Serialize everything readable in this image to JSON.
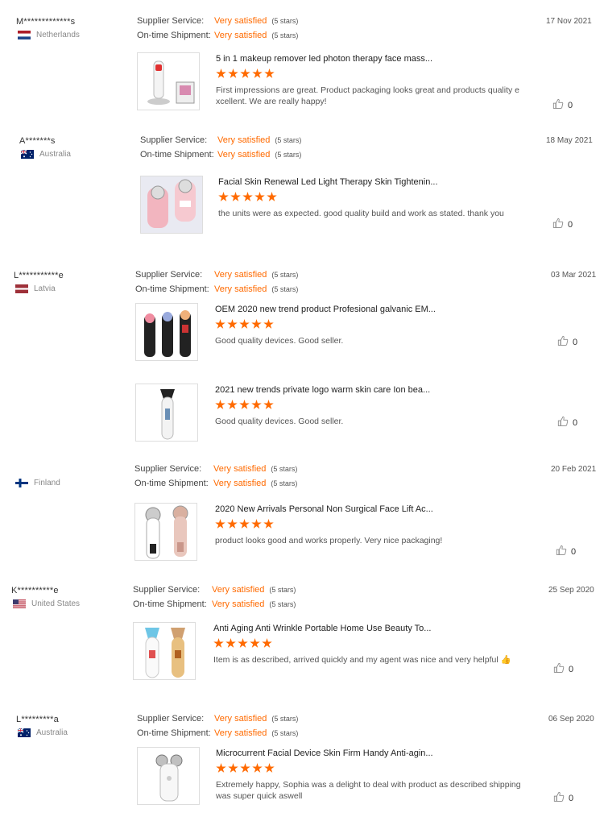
{
  "reviews": [
    {
      "buyer": "M*************s",
      "country": "Netherlands",
      "flag": "netherlands",
      "supplier_label": "Supplier Service:",
      "supplier_value": "Very satisfied",
      "supplier_stars": "(5 stars)",
      "shipment_label": "On-time Shipment:",
      "shipment_value": "Very satisfied",
      "shipment_stars": "(5 stars)",
      "date": "17 Nov 2021",
      "products": [
        {
          "title": "5 in 1 makeup remover led photon therapy face mass...",
          "rating": 5,
          "text": "First impressions are great. Product packaging looks great and products quality e xcellent. We are really happy!",
          "likes": "0",
          "image_icon": "face-massager-image"
        }
      ]
    },
    {
      "buyer": "A*******s",
      "country": "Australia",
      "flag": "australia",
      "supplier_label": "Supplier Service:",
      "supplier_value": "Very satisfied",
      "supplier_stars": "(5 stars)",
      "shipment_label": "On-time Shipment:",
      "shipment_value": "Very satisfied",
      "shipment_stars": "(5 stars)",
      "date": "18 May 2021",
      "products": [
        {
          "title": "Facial Skin Renewal Led Light Therapy Skin Tightenin...",
          "rating": 5,
          "text": "the units were as expected. good quality build and work as stated. thank you",
          "likes": "0",
          "image_icon": "pink-device-image"
        }
      ]
    },
    {
      "buyer": "L***********e",
      "country": "Latvia",
      "flag": "latvia",
      "supplier_label": "Supplier Service:",
      "supplier_value": "Very satisfied",
      "supplier_stars": "(5 stars)",
      "shipment_label": "On-time Shipment:",
      "shipment_value": "Very satisfied",
      "shipment_stars": "(5 stars)",
      "date": "03 Mar 2021",
      "products": [
        {
          "title": "OEM 2020 new trend product Profesional galvanic EM...",
          "rating": 5,
          "text": "Good quality devices. Good seller.",
          "likes": "0",
          "image_icon": "three-devices-image"
        },
        {
          "title": "2021 new trends private logo warm skin care Ion bea...",
          "rating": 5,
          "text": "Good quality devices. Good seller.",
          "likes": "0",
          "image_icon": "white-device-image"
        }
      ]
    },
    {
      "buyer": "",
      "country": "Finland",
      "flag": "finland",
      "supplier_label": "Supplier Service:",
      "supplier_value": "Very satisfied",
      "supplier_stars": "(5 stars)",
      "shipment_label": "On-time Shipment:",
      "shipment_value": "Very satisfied",
      "shipment_stars": "(5 stars)",
      "date": "20 Feb 2021",
      "products": [
        {
          "title": "2020 New Arrivals Personal Non Surgical Face Lift Ac...",
          "rating": 5,
          "text": "product looks good and works properly. Very nice packaging!",
          "likes": "0",
          "image_icon": "two-devices-image"
        }
      ]
    },
    {
      "buyer": "K**********e",
      "country": "United States",
      "flag": "united-states",
      "supplier_label": "Supplier Service:",
      "supplier_value": "Very satisfied",
      "supplier_stars": "(5 stars)",
      "shipment_label": "On-time Shipment:",
      "shipment_value": "Very satisfied",
      "shipment_stars": "(5 stars)",
      "date": "25 Sep 2020",
      "products": [
        {
          "title": "Anti Aging Anti Wrinkle Portable Home Use Beauty To...",
          "rating": 5,
          "text": "Item is as described, arrived quickly and my agent was nice and very helpful 👍",
          "likes": "0",
          "image_icon": "gold-white-devices-image"
        }
      ]
    },
    {
      "buyer": "L*********a",
      "country": "Australia",
      "flag": "australia",
      "supplier_label": "Supplier Service:",
      "supplier_value": "Very satisfied",
      "supplier_stars": "(5 stars)",
      "shipment_label": "On-time Shipment:",
      "shipment_value": "Very satisfied",
      "shipment_stars": "(5 stars)",
      "date": "06 Sep 2020",
      "products": [
        {
          "title": "Microcurrent Facial Device Skin Firm Handy Anti-agin...",
          "rating": 5,
          "text": "Extremely happy, Sophia was a delight to deal with product as described shipping was super quick aswell",
          "likes": "0",
          "image_icon": "roller-device-image"
        }
      ]
    }
  ],
  "colors": {
    "accent": "#ff6a00",
    "text": "#333333",
    "muted": "#888888"
  }
}
